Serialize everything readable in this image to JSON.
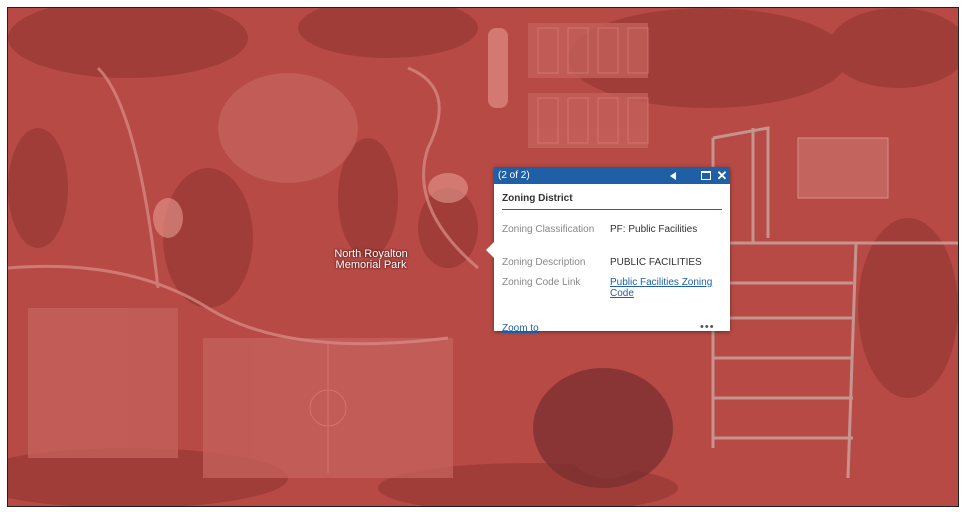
{
  "map": {
    "overlay_color": "#b84a45",
    "park_label": "North Royalton Memorial Park"
  },
  "popup": {
    "count": "(2 of 2)",
    "title": "Zoning District",
    "header_color": "#1f5fa6",
    "icons": [
      "previous-arrow-icon",
      "maximize-icon",
      "close-icon",
      "more-options-icon"
    ],
    "rows": [
      {
        "label": "Zoning Classification",
        "value": "PF: Public Facilities"
      },
      {
        "label": "Zoning Description",
        "value": "PUBLIC FACILITIES"
      },
      {
        "label": "Zoning Code Link",
        "value": "Public Facilities Zoning Code"
      }
    ],
    "zoom_to": "Zoom to",
    "more": "•••"
  }
}
